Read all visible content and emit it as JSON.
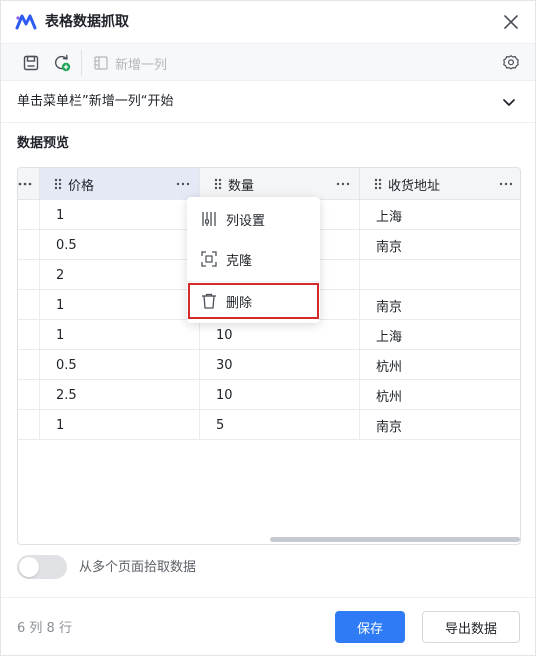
{
  "window": {
    "title": "表格数据抓取"
  },
  "toolbar": {
    "add_column_label": "新增一列"
  },
  "hint": {
    "text": "单击菜单栏”新增一列“开始"
  },
  "preview": {
    "title": "数据预览"
  },
  "table": {
    "columns": [
      "价格",
      "数量",
      "收货地址"
    ],
    "rows": [
      [
        "1",
        "",
        "上海"
      ],
      [
        "0.5",
        "",
        "南京"
      ],
      [
        "2",
        "",
        ""
      ],
      [
        "1",
        "",
        "南京"
      ],
      [
        "1",
        "10",
        "上海"
      ],
      [
        "0.5",
        "30",
        "杭州"
      ],
      [
        "2.5",
        "10",
        "杭州"
      ],
      [
        "1",
        "5",
        "南京"
      ]
    ]
  },
  "context_menu": {
    "items": [
      "列设置",
      "克隆",
      "删除"
    ]
  },
  "toggle": {
    "label": "从多个页面拾取数据",
    "on": false
  },
  "footer": {
    "count_text": "6 列 8 行",
    "save_label": "保存",
    "export_label": "导出数据"
  },
  "colors": {
    "accent": "#2f7bf5",
    "highlight_border": "#d42a2a",
    "active_header": "#e4e9f5"
  }
}
